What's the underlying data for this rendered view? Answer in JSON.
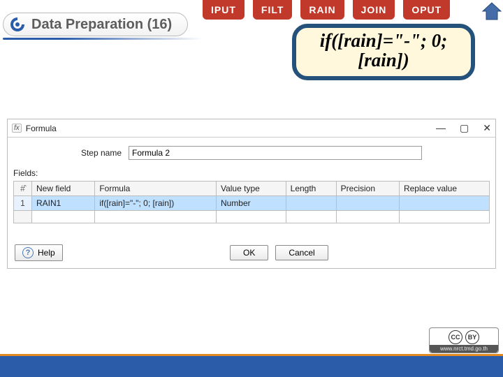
{
  "tabs": [
    "IPUT",
    "FILT",
    "RAIN",
    "JOIN",
    "OPUT"
  ],
  "breadcrumb": {
    "title": "Data Preparation (16)"
  },
  "callout": {
    "formula": "if([rain]=\"-\"; 0; [rain])"
  },
  "dialog": {
    "title": "Formula",
    "step_label": "Step name",
    "step_value": "Formula 2",
    "fields_label": "Fields:",
    "columns": [
      "New field",
      "Formula",
      "Value type",
      "Length",
      "Precision",
      "Replace value"
    ],
    "rows": [
      {
        "num": "1",
        "new_field": "RAIN1",
        "formula": "if([rain]=\"-\"; 0; [rain])",
        "value_type": "Number",
        "length": "",
        "precision": "",
        "replace": ""
      }
    ],
    "buttons": {
      "help": "Help",
      "ok": "OK",
      "cancel": "Cancel"
    }
  },
  "cc_url": "www.nrct.tmd.go.th"
}
